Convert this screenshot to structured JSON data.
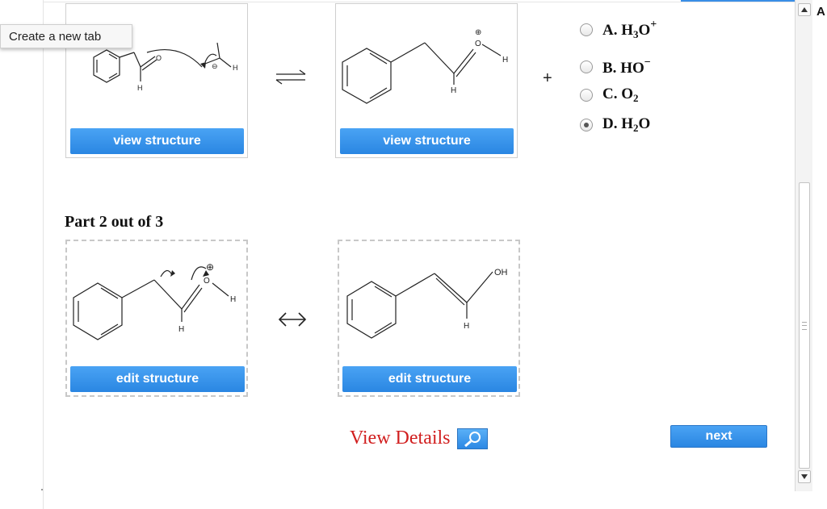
{
  "tooltip": {
    "text": "Create a new tab"
  },
  "part1": {
    "reactant": {
      "button_label": "view structure",
      "atom_o": "O",
      "atom_h": "H",
      "atom_h2": "H",
      "charge": "⊖"
    },
    "product": {
      "button_label": "view structure",
      "atom_o": "O",
      "atom_h": "H",
      "atom_h2": "H",
      "charge": "⊕"
    },
    "plus_sign": "+"
  },
  "options": [
    {
      "letter": "A.",
      "base": "H",
      "sub": "3",
      "tail": "O",
      "sup": "+",
      "checked": false
    },
    {
      "letter": "B.",
      "base": "HO",
      "sub": "",
      "tail": "",
      "sup": "−",
      "checked": false
    },
    {
      "letter": "C.",
      "base": "O",
      "sub": "2",
      "tail": "",
      "sup": "",
      "checked": false
    },
    {
      "letter": "D.",
      "base": "H",
      "sub": "2",
      "tail": "O",
      "sup": "",
      "checked": true
    }
  ],
  "part2": {
    "title": "Part 2 out of 3",
    "left": {
      "button_label": "edit structure",
      "atom_o": "O",
      "atom_h": "H",
      "atom_h2": "H",
      "charge": "⊕"
    },
    "right": {
      "button_label": "edit structure",
      "atom_oh": "OH",
      "atom_h": "H"
    }
  },
  "view_details": {
    "label": "View Details"
  },
  "next_button": {
    "label": "next"
  },
  "scrollbar": {
    "edge_letter": "A"
  },
  "colors": {
    "accent_blue": "#2a86e2",
    "link_red": "#d11f1f"
  }
}
